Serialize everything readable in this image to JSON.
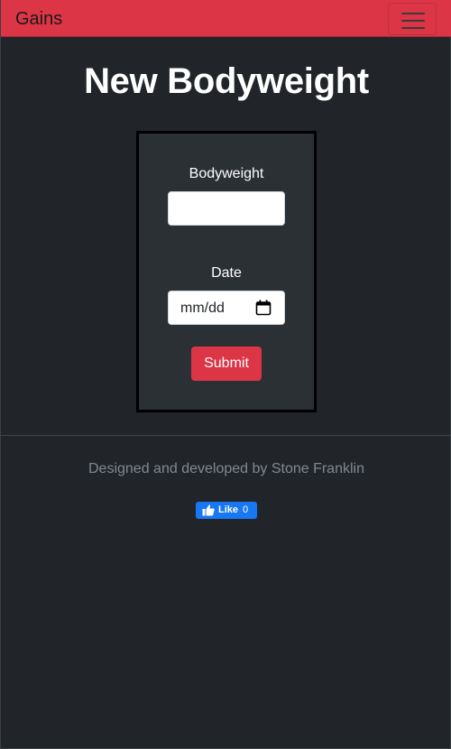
{
  "navbar": {
    "brand": "Gains",
    "toggler_icon": "hamburger-menu-icon",
    "accent_color": "#dc3545"
  },
  "page": {
    "title": "New Bodyweight"
  },
  "form": {
    "bodyweight_label": "Bodyweight",
    "bodyweight_value": "",
    "date_label": "Date",
    "date_placeholder": "mm/dd",
    "date_icon": "calendar-icon",
    "submit_label": "Submit"
  },
  "footer": {
    "credit": "Designed and developed by Stone Franklin",
    "like_label": "Like",
    "like_count": "0",
    "like_icon": "thumbs-up-icon"
  }
}
